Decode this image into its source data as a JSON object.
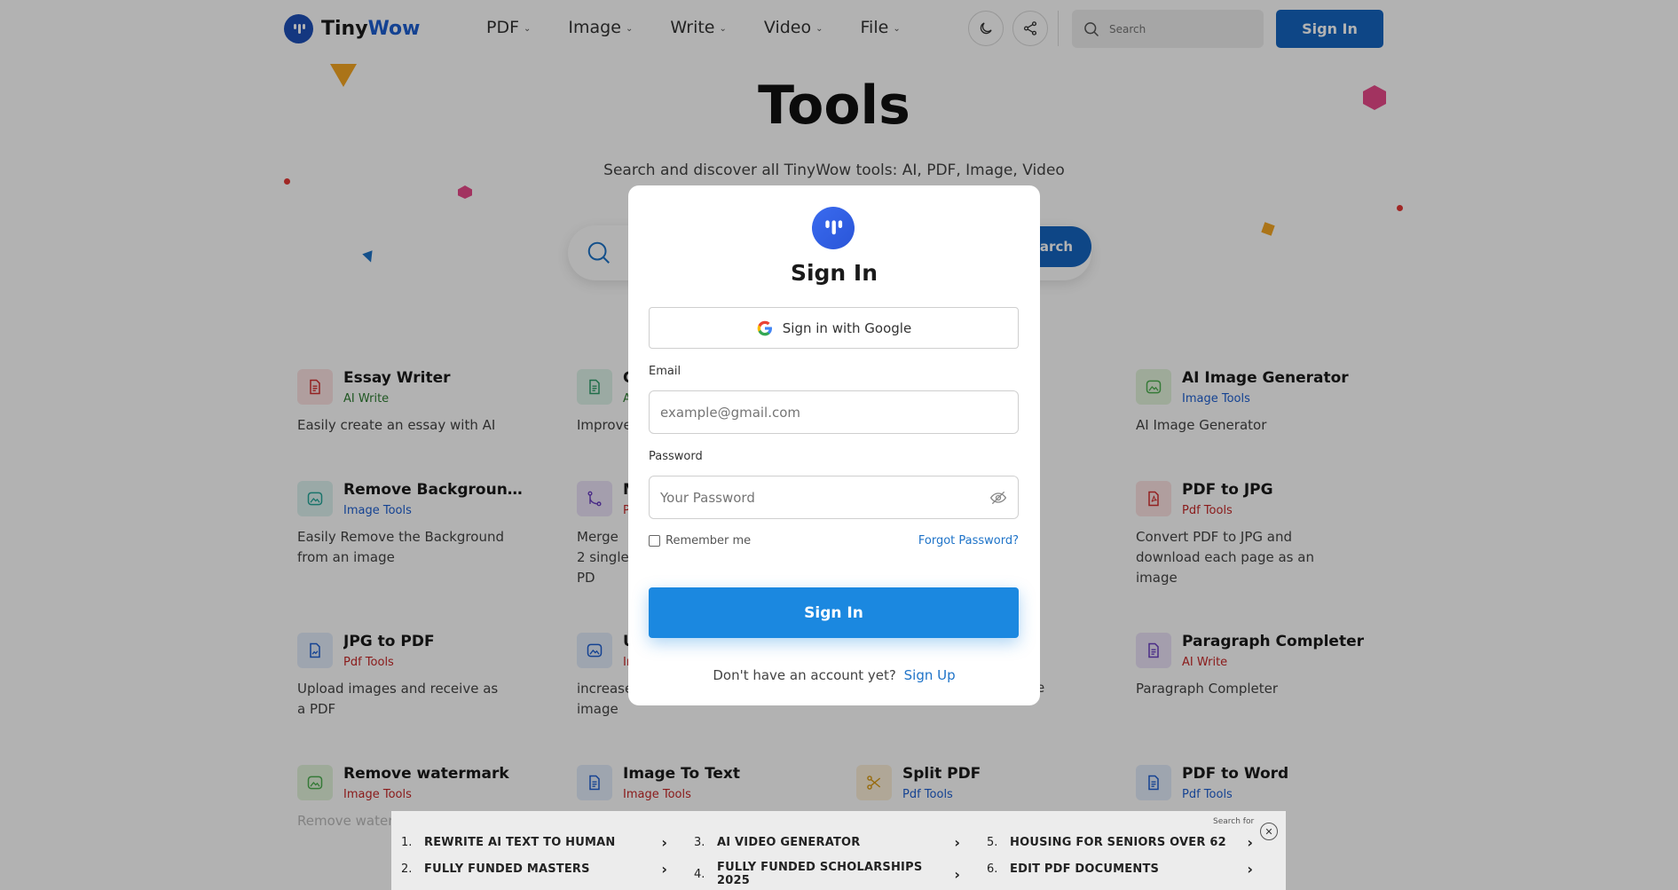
{
  "header": {
    "logo": {
      "tiny": "Tiny",
      "wow": "Wow"
    },
    "nav": [
      {
        "label": "PDF"
      },
      {
        "label": "Image"
      },
      {
        "label": "Write"
      },
      {
        "label": "Video"
      },
      {
        "label": "File"
      }
    ],
    "search_placeholder": "Search",
    "signin_label": "Sign In"
  },
  "hero": {
    "title": "Tools",
    "subtitle": "Search and discover all TinyWow tools: AI, PDF, Image, Video",
    "search_button": "Search"
  },
  "tools": [
    {
      "name": "Essay Writer",
      "category": "AI Write",
      "desc": "Easily create an essay with AI",
      "icon": "document-icon"
    },
    {
      "name": "C",
      "category": "A",
      "desc": "Improve",
      "icon": "document-icon"
    },
    {
      "name": "AI Image Generator",
      "category": "Image Tools",
      "desc": "AI Image Generator",
      "icon": "image-icon"
    },
    {
      "name": "Remove Background...",
      "category": "Image Tools",
      "desc": "Easily Remove the Background from an image",
      "icon": "image-icon"
    },
    {
      "name": "M",
      "category": "P",
      "desc": "Merge 2 single PD",
      "icon": "merge-icon"
    },
    {
      "name": "PDF to JPG",
      "category": "Pdf Tools",
      "desc": "Convert PDF to JPG and download each page as an image",
      "icon": "pdf-icon"
    },
    {
      "name": "JPG to PDF",
      "category": "Pdf Tools",
      "desc": "Upload images and receive as a PDF",
      "icon": "document-icon"
    },
    {
      "name": "U",
      "category": "Im",
      "desc": "increase image",
      "icon": "image-icon"
    },
    {
      "name": "Paragraph Completer",
      "category": "AI Write",
      "desc": "Paragraph Completer",
      "icon": "document-icon"
    },
    {
      "name": "Remove watermark",
      "category": "Image Tools",
      "desc": "Remove watermark",
      "icon": "image-icon"
    },
    {
      "name": "Image To Text",
      "category": "Image Tools",
      "desc": "",
      "icon": "document-icon"
    },
    {
      "name": "Split PDF",
      "category": "Pdf Tools",
      "desc": "",
      "icon": "scissors-icon"
    },
    {
      "name": "PDF to Word",
      "category": "Pdf Tools",
      "desc": "",
      "icon": "document-icon"
    }
  ],
  "modal": {
    "title": "Sign In",
    "google_label": "Sign in with Google",
    "email_label": "Email",
    "email_placeholder": "example@gmail.com",
    "password_label": "Password",
    "password_placeholder": "Your Password",
    "remember_label": "Remember me",
    "forgot_label": "Forgot Password?",
    "signin_label": "Sign In",
    "account_text": "Don't have an account yet?",
    "signup_label": "Sign Up",
    "partial_right": "e"
  },
  "ad": {
    "search_for": "Search for",
    "items": [
      {
        "num": "1.",
        "label": "REWRITE AI TEXT TO HUMAN"
      },
      {
        "num": "2.",
        "label": "FULLY FUNDED MASTERS"
      },
      {
        "num": "3.",
        "label": "AI VIDEO GENERATOR"
      },
      {
        "num": "4.",
        "label": "FULLY FUNDED SCHOLARSHIPS 2025"
      },
      {
        "num": "5.",
        "label": "HOUSING FOR SENIORS OVER 62"
      },
      {
        "num": "6.",
        "label": "EDIT PDF DOCUMENTS"
      }
    ]
  },
  "colors": {
    "primary": "#1565c0",
    "modal_button": "#1b88e0",
    "link": "#1e73c8"
  }
}
